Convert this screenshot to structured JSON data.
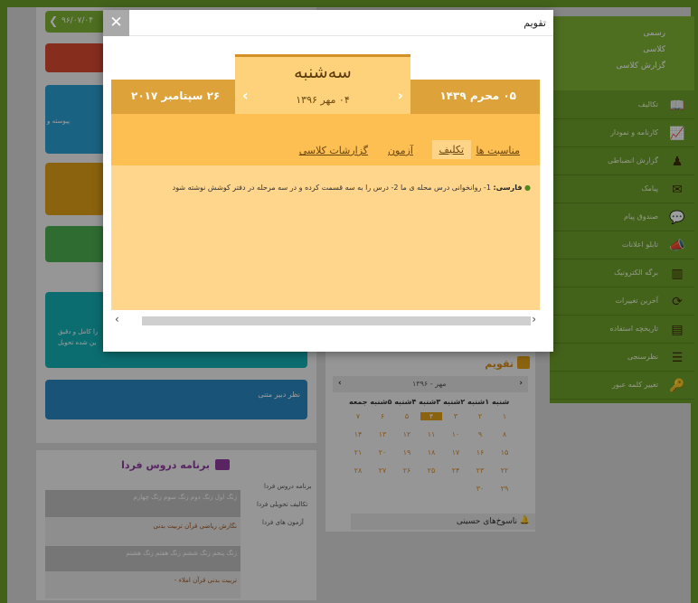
{
  "top": {
    "date_badge": "۹۶/۰۷/۰۴"
  },
  "sidebar": {
    "sub_items": [
      "رسمی",
      "کلاسی",
      "گزارش کلاسی"
    ],
    "items": [
      {
        "label": "تکالیف",
        "icon": "book-icon"
      },
      {
        "label": "کارنامه و نمودار",
        "icon": "chart-icon"
      },
      {
        "label": "گزارش انضباطی",
        "icon": "discipline-icon"
      },
      {
        "label": "پیامک",
        "icon": "envelope-icon"
      },
      {
        "label": "صندوق پیام",
        "icon": "chat-icon"
      },
      {
        "label": "تابلو اعلانات",
        "icon": "megaphone-icon"
      },
      {
        "label": "برگه الکترونیک",
        "icon": "barcode-icon"
      },
      {
        "label": "آخرین تغییرات",
        "icon": "refresh-icon"
      },
      {
        "label": "تاریخچه استفاده",
        "icon": "archive-icon"
      },
      {
        "label": "نظرسنجی",
        "icon": "list-icon"
      },
      {
        "label": "تغییر کلمه عبور",
        "icon": "key-icon"
      }
    ]
  },
  "background": {
    "card_teal_text": [
      "را کامل و دقیق",
      "ین شده تحویل"
    ],
    "card_blue_text": "نظر دبیر متنی",
    "card_yellow_text": "پیوسته و",
    "calendar_title": "تقویم",
    "calendar_month": "مهر - ۱۳۹۶",
    "calendar_weekdays": "شنبه ۱شنبه ۲شنبه ۳شنبه ۴شنبه ۵شنبه جمعه",
    "calendar_rows": [
      [
        "۱",
        "۲",
        "۳",
        "۴",
        "۵",
        "۶",
        "۷"
      ],
      [
        "۸",
        "۹",
        "۱۰",
        "۱۱",
        "۱۲",
        "۱۳",
        "۱۴"
      ],
      [
        "۱۵",
        "۱۶",
        "۱۷",
        "۱۸",
        "۱۹",
        "۲۰",
        "۲۱"
      ],
      [
        "۲۲",
        "۲۳",
        "۲۴",
        "۲۵",
        "۲۶",
        "۲۷",
        "۲۸"
      ],
      [
        "۲۹",
        "۳۰",
        "",
        "",
        "",
        "",
        ""
      ]
    ],
    "calendar_today": "۴",
    "occasions_label": "ناسوخ‌های حسینی",
    "schedule_title": "برنامه دروس فردا",
    "schedule_links": [
      "برنامه دروس فردا",
      "تکالیف تحویلی فردا",
      "آزمون های فردا"
    ],
    "schedule_headers_1": [
      "زنگ اول",
      "زنگ دوم",
      "زنگ سوم",
      "زنگ چهارم"
    ],
    "schedule_row_1": [
      "نگارش",
      "ریاضی",
      "قرآن",
      "تربیت بدنی"
    ],
    "schedule_headers_2": [
      "زنگ پنجم",
      "زنگ ششم",
      "زنگ هفتم",
      "زنگ هشتم"
    ],
    "schedule_row_2": [
      "تربیت بدنی",
      "قرآن",
      "املاء",
      "-"
    ]
  },
  "modal": {
    "title": "تقویم",
    "close_label": "✕",
    "weekday": "سه‌شنبه",
    "shamsi_date": "۰۴ مهر ۱۳۹۶",
    "gregorian_date": "۲۶ سپتامبر ۲۰۱۷",
    "hijri_date": "۰۵ محرم ۱۴۳۹",
    "tabs": [
      "مناسبت ها",
      "تکلیف",
      "آزمون",
      "گزارشات کلاسی"
    ],
    "active_tab_index": 1,
    "homework": {
      "subject": "فارسی:",
      "text": "1- روانخوانی درس محله ی ما 2- درس را به سه قسمت کرده و در سه مرحله در دفتر کوشش نوشته شود"
    }
  },
  "colors": {
    "sidebar_green": "#6ea12a",
    "strip_orange": "#dda23a",
    "tab_orange": "#fdbf52",
    "content_orange": "#ffd68c",
    "teal_card": "#14b1b6",
    "blue_card": "#2b87c2"
  }
}
